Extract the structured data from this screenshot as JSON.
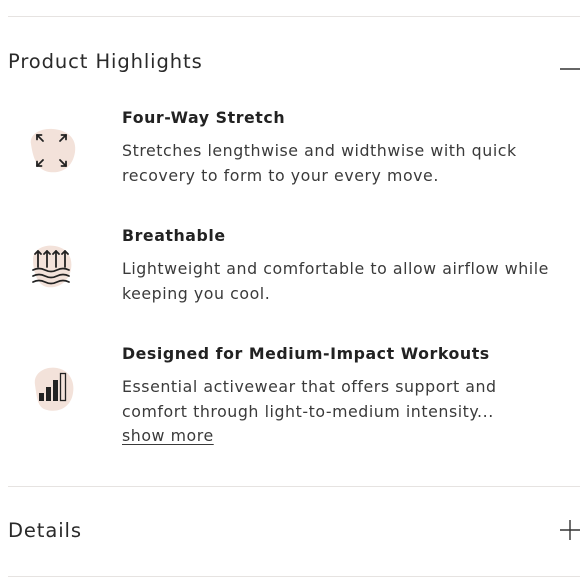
{
  "product_highlights": {
    "title": "Product Highlights",
    "toggle_icon": "minus-icon",
    "items": [
      {
        "title": "Four-Way Stretch",
        "desc_lines": [
          "Stretches lengthwise and widthwise with quick",
          "recovery to form to your every move."
        ],
        "icon": "four-way-arrows-icon"
      },
      {
        "title": "Breathable",
        "desc_lines": [
          "Lightweight and comfortable to allow airflow while",
          "keeping you cool."
        ],
        "icon": "airflow-icon"
      },
      {
        "title": "Designed for Medium-Impact Workouts",
        "desc_lines": [
          "Essential activewear that offers support and",
          "comfort through light-to-medium intensity..."
        ],
        "show_more": "show more",
        "icon": "intensity-bars-icon"
      }
    ]
  },
  "details": {
    "title": "Details",
    "toggle_icon": "plus-icon"
  },
  "colors": {
    "icon_blob": "#f3e2da",
    "icon_stroke": "#222222",
    "divider": "#e6e3e1"
  }
}
